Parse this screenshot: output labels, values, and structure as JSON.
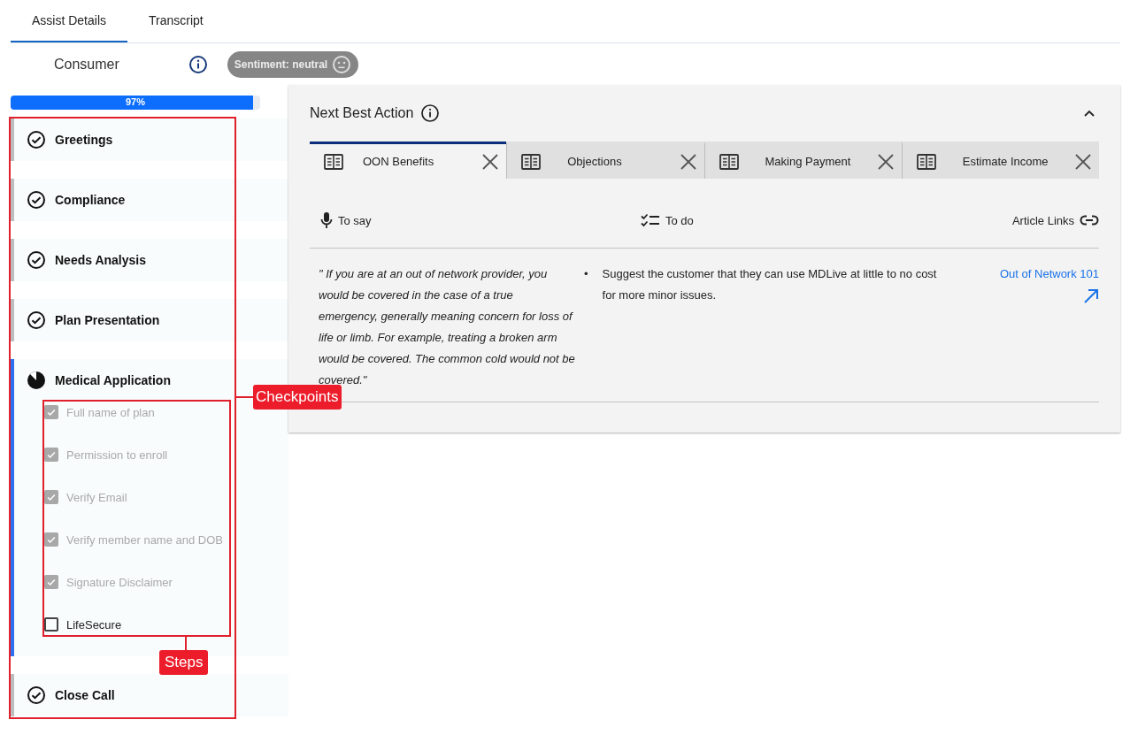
{
  "tabs": [
    {
      "label": "Assist Details",
      "selected": true
    },
    {
      "label": "Transcript",
      "selected": false
    }
  ],
  "consumer": {
    "label": "Consumer",
    "sentiment": "Sentiment: neutral"
  },
  "progress": {
    "level": 0.97,
    "label": "97%"
  },
  "sections": [
    {
      "title": "Greetings",
      "complete": true,
      "active": false
    },
    {
      "title": "Compliance",
      "complete": true,
      "active": false
    },
    {
      "title": "Needs Analysis",
      "complete": true,
      "active": false
    },
    {
      "title": "Plan Presentation",
      "complete": true,
      "active": false
    },
    {
      "title": "Medical Application",
      "complete": false,
      "active": true,
      "steps": [
        {
          "label": "Full name of plan",
          "checked": true
        },
        {
          "label": "Permission to enroll",
          "checked": true
        },
        {
          "label": "Verify Email",
          "checked": true
        },
        {
          "label": "Verify member name and DOB",
          "checked": true
        },
        {
          "label": "Signature Disclaimer",
          "checked": true
        },
        {
          "label": "LifeSecure",
          "checked": false
        }
      ]
    },
    {
      "title": "Close Call",
      "complete": true,
      "active": false
    }
  ],
  "next_best_action": {
    "title": "Next Best Action",
    "expanded": true,
    "tabs": [
      {
        "label": "OON Benefits",
        "selected": true
      },
      {
        "label": "Objections",
        "selected": false
      },
      {
        "label": "Making Payment",
        "selected": false
      },
      {
        "label": "Estimate Income",
        "selected": false
      }
    ],
    "columns": [
      {
        "label": "To say",
        "kind": "say"
      },
      {
        "label": "To do",
        "kind": "todo"
      },
      {
        "label": "Article Links",
        "kind": "links"
      }
    ],
    "to_say": "\" If you are at an out of network provider, you would be covered in the case of a true emergency, generally meaning concern for loss of life or limb. For example, treating a broken arm would be covered. The common cold would not be covered.\"",
    "to_do": [
      {
        "marker": "•",
        "text": "Suggest the customer that they can use MDLive at little to no cost for more minor issues."
      }
    ],
    "links": [
      {
        "label": "Out of Network 101"
      }
    ]
  },
  "annotations": [
    {
      "label": "Checkpoints",
      "kind": "checkpoints"
    },
    {
      "label": "Steps",
      "kind": "steps"
    }
  ]
}
